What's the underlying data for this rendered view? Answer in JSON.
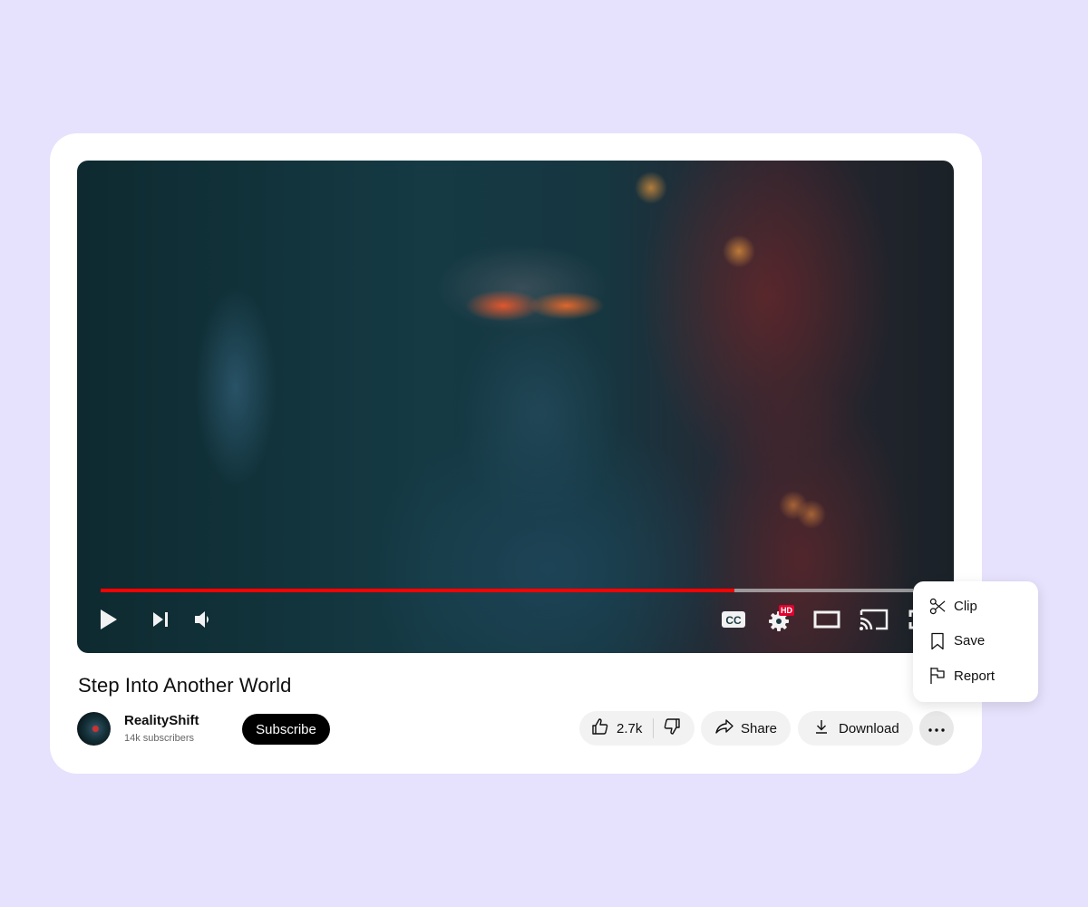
{
  "video": {
    "title": "Step Into Another World",
    "progress_percent": 78,
    "controls": {
      "play": "play-icon",
      "next": "skip-next-icon",
      "volume": "volume-icon",
      "captions": "closed-captions-icon",
      "settings": "settings-gear-icon",
      "settings_badge": "HD",
      "theater": "theater-mode-icon",
      "cast": "cast-icon",
      "fullscreen": "fullscreen-icon"
    },
    "colors": {
      "progress_played": "#ff0000",
      "badge": "#e1002d"
    }
  },
  "channel": {
    "name": "RealityShift",
    "subscribers": "14k subscribers",
    "subscribe_label": "Subscribe"
  },
  "actions": {
    "likes": "2.7k",
    "share_label": "Share",
    "download_label": "Download",
    "more_icon": "more-horizontal-icon"
  },
  "menu": {
    "items": [
      {
        "label": "Clip",
        "icon": "scissors-icon"
      },
      {
        "label": "Save",
        "icon": "bookmark-icon"
      },
      {
        "label": "Report",
        "icon": "flag-icon"
      }
    ]
  }
}
